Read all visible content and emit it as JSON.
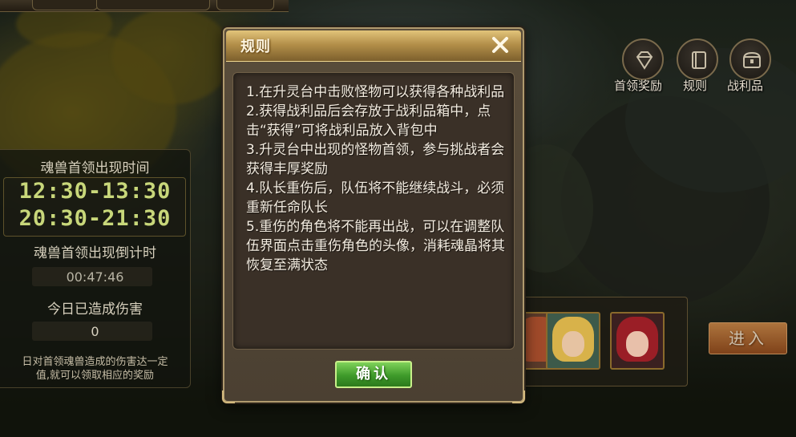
{
  "modal": {
    "title": "规则",
    "close_icon": "close-icon",
    "rules": [
      "1.在升灵台中击败怪物可以获得各种战利品",
      "2.获得战利品后会存放于战利品箱中，点击“获得”可将战利品放入背包中",
      "3.升灵台中出现的怪物首领，参与挑战者会获得丰厚奖励",
      "4.队长重伤后，队伍将不能继续战斗，必须重新任命队长",
      "5.重伤的角色将不能再出战，可以在调整队伍界面点击重伤角色的头像，消耗魂晶将其恢复至满状态"
    ],
    "confirm_label": "确认"
  },
  "left_panel": {
    "boss_time_label": "魂兽首领出现时间",
    "boss_times": [
      "12:30-13:30",
      "20:30-21:30"
    ],
    "countdown_label": "魂兽首领出现倒计时",
    "countdown_value": "00:47:46",
    "damage_label": "今日已造成伤害",
    "damage_value": "0",
    "note_line1": "日对首领魂兽造成的伤害达一定",
    "note_line2": "值,就可以领取相应的奖励"
  },
  "right_icons": [
    {
      "label": "首领奖励",
      "icon": "diamond-icon"
    },
    {
      "label": "规则",
      "icon": "book-icon"
    },
    {
      "label": "战利品",
      "icon": "chest-icon"
    }
  ],
  "enter_label": "进入",
  "colors": {
    "header_gold": "#c9a55a",
    "confirm_green": "#4caf32",
    "time_green": "#c8d77a",
    "enter_orange": "#c0703a"
  }
}
